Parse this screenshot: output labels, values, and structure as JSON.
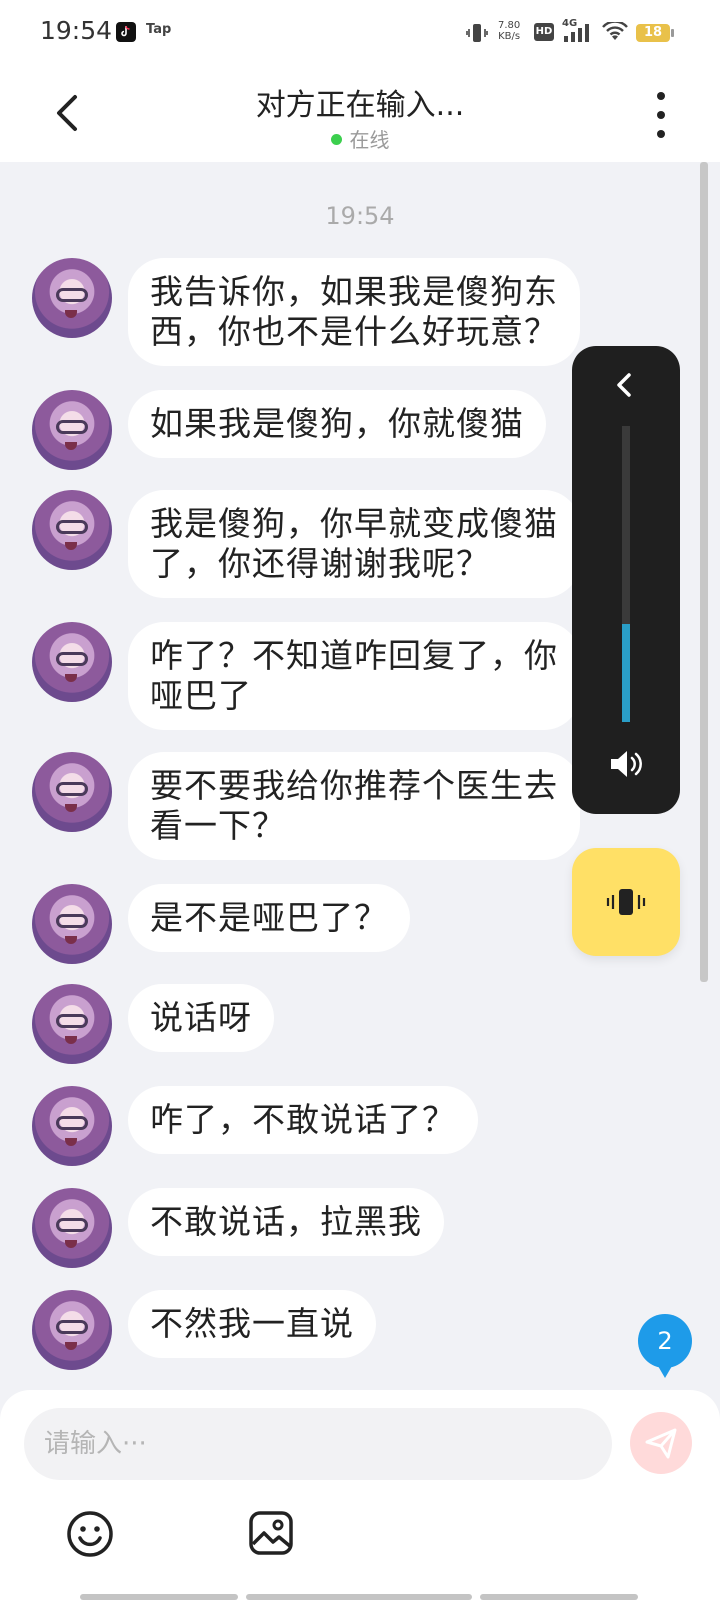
{
  "status_bar": {
    "time": "19:54",
    "app_icons": [
      "tiktok-icon"
    ],
    "tap_label": "Tap",
    "net_speed_value": "7.80",
    "net_speed_unit": "KB/s",
    "hd_label": "HD",
    "network_label": "4G",
    "battery_level": "18"
  },
  "header": {
    "title": "对方正在输入...",
    "status": "在线",
    "status_color": "#3ccf4e"
  },
  "chat": {
    "time_divider": "19:54",
    "messages": [
      {
        "text_line1": "我告诉你，如果我是傻狗东",
        "text_line2": "西，你也不是什么好玩意？"
      },
      {
        "text_line1": "如果我是傻狗，你就傻猫"
      },
      {
        "text_line1": "我是傻狗，你早就变成傻猫",
        "text_line2": "了，你还得谢谢我呢？"
      },
      {
        "text_line1": "咋了？不知道咋回复了，你",
        "text_line2": "哑巴了"
      },
      {
        "text_line1": "要不要我给你推荐个医生去",
        "text_line2": "看一下？"
      },
      {
        "text_line1": "是不是哑巴了？"
      },
      {
        "text_line1": "说话呀"
      },
      {
        "text_line1": "咋了，不敢说话了？"
      },
      {
        "text_line1": "不敢说话，拉黑我"
      },
      {
        "text_line1": "不然我一直说"
      }
    ],
    "unread_count": "2"
  },
  "volume_panel": {
    "level": 0.33,
    "accent_color": "#2a9ec7"
  },
  "input": {
    "placeholder": "请输入···"
  },
  "icons": {
    "back": "back-arrow-icon",
    "more": "more-vertical-icon",
    "speaker": "speaker-icon",
    "vibrate": "vibrate-icon",
    "send": "send-icon",
    "emoji": "emoji-icon",
    "image": "image-icon"
  }
}
